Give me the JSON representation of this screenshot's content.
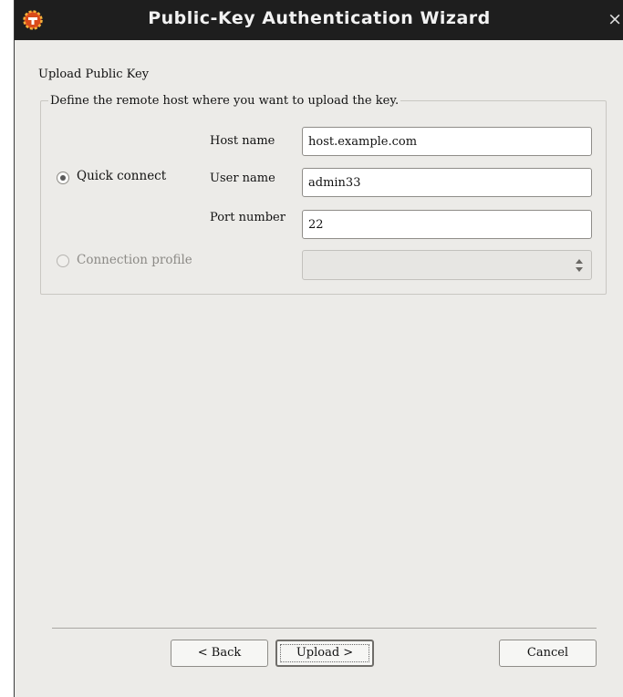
{
  "window": {
    "title": "Public-Key Authentication Wizard",
    "close_glyph": "×",
    "app_icon": "gear-shield-icon"
  },
  "page": {
    "heading": "Upload Public Key",
    "group_label": "Define the remote host where you want to upload the key."
  },
  "form": {
    "quick_connect": {
      "label": "Quick connect",
      "selected": true
    },
    "connection_profile": {
      "label": "Connection profile",
      "selected": false,
      "enabled": false,
      "value": ""
    },
    "host_name": {
      "label": "Host name",
      "value": "host.example.com"
    },
    "user_name": {
      "label": "User name",
      "value": "admin33"
    },
    "port_number": {
      "label": "Port number",
      "value": "22"
    }
  },
  "buttons": {
    "back": "< Back",
    "upload": "Upload >",
    "cancel": "Cancel"
  },
  "colors": {
    "titlebar": "#1e1e1e",
    "window_bg": "#ecebe8",
    "app_icon_accent": "#d94a1a"
  }
}
